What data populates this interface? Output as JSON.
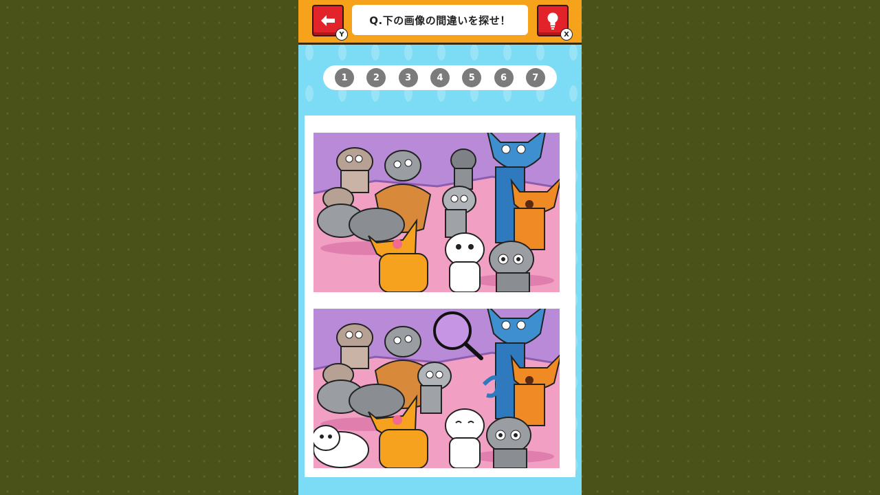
{
  "header": {
    "question": "Q.下の画像の間違いを探せ！",
    "back_key": "Y",
    "hint_key": "X"
  },
  "progress": {
    "items": [
      "1",
      "2",
      "3",
      "4",
      "5",
      "6",
      "7"
    ]
  },
  "colors": {
    "background": "#4a5219",
    "panel": "#5fd3f3",
    "header": "#f7a21b",
    "button": "#e2242a",
    "dot": "#7b7b7b"
  },
  "icons": {
    "back": "arrow-left-icon",
    "hint": "lightbulb-icon",
    "magnifier": "magnifier-icon"
  }
}
